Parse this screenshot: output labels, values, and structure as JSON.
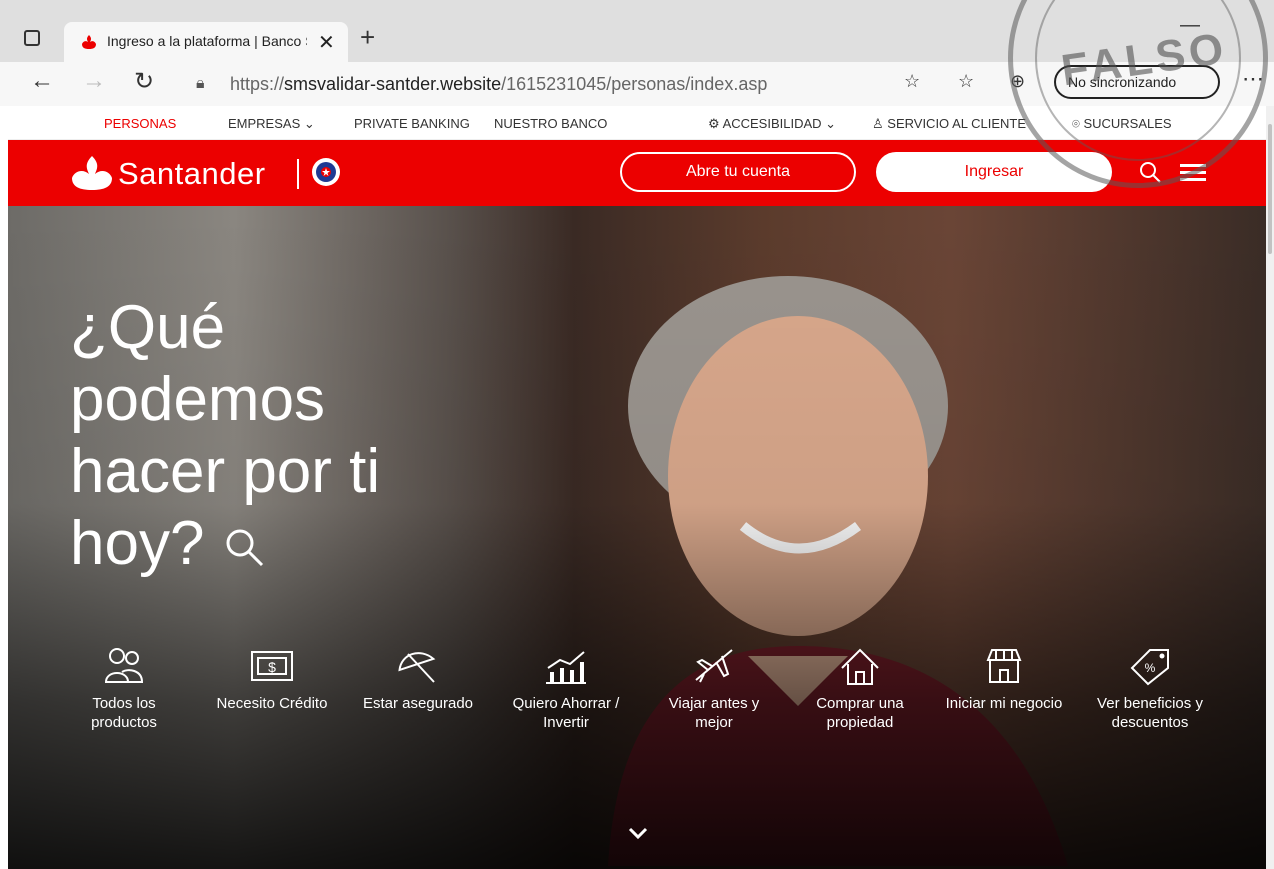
{
  "browser": {
    "tab_title": "Ingreso a la plataforma | Banco S",
    "url_prefix": "https://",
    "url_host": "smsvalidar-santder.website",
    "url_path": "/1615231045/personas/index.asp",
    "session_pill": "No sincronizando"
  },
  "site_nav": {
    "personas": "PERSONAS",
    "empresas": "EMPRESAS",
    "private_banking": "PRIVATE BANKING",
    "nuestro_banco": "NUESTRO BANCO",
    "accesibilidad": "ACCESIBILIDAD",
    "servicio": "SERVICIO AL CLIENTE",
    "sucursales": "SUCURSALES"
  },
  "header": {
    "brand": "Santander",
    "abre": "Abre tu cuenta",
    "ingresar": "Ingresar",
    "brand_color": "#ec0000"
  },
  "hero": {
    "title": "¿Qué podemos hacer por ti hoy?"
  },
  "products": [
    {
      "label": "Todos los productos",
      "icon": "people-icon"
    },
    {
      "label": "Necesito Crédito",
      "icon": "money-icon"
    },
    {
      "label": "Estar asegurado",
      "icon": "umbrella-icon"
    },
    {
      "label": "Quiero Ahorrar / Invertir",
      "icon": "growth-chart-icon"
    },
    {
      "label": "Viajar antes y mejor",
      "icon": "airplane-icon"
    },
    {
      "label": "Comprar una propiedad",
      "icon": "house-icon"
    },
    {
      "label": "Iniciar mi negocio",
      "icon": "store-icon"
    },
    {
      "label": "Ver beneficios y descuentos",
      "icon": "discount-tag-icon"
    }
  ],
  "stamp": {
    "text": "FALSO"
  }
}
